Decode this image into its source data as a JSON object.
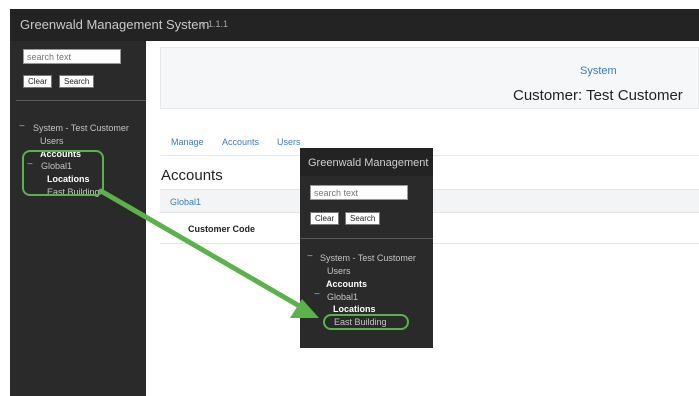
{
  "app": {
    "title": "Greenwald Management System",
    "version": "v 1.1.1"
  },
  "sidebar": {
    "search": {
      "placeholder": "search text",
      "value": ""
    },
    "clear_label": "Clear",
    "search_label": "Search",
    "tree": {
      "root_toggle": "−",
      "root_label": "System - Test Customer",
      "users_label": "Users",
      "accounts_label": "Accounts",
      "global_toggle": "−",
      "global_label": "Global1",
      "locations_label": "Locations",
      "east_building_label": "East Building"
    }
  },
  "header": {
    "system_link": "System",
    "customer_title": "Customer: Test Customer"
  },
  "tabs": [
    {
      "label": "Manage"
    },
    {
      "label": "Accounts"
    },
    {
      "label": "Users"
    }
  ],
  "accounts": {
    "title": "Accounts",
    "global_row": "Global1",
    "customer_code_label": "Customer Code"
  },
  "zoom": {
    "title": "Greenwald Management",
    "search": {
      "placeholder": "search text",
      "value": ""
    },
    "clear_label": "Clear",
    "search_label": "Search",
    "tree": {
      "root_toggle": "−",
      "root_label": "System - Test Customer",
      "users_label": "Users",
      "accounts_label": "Accounts",
      "global_toggle": "−",
      "global_label": "Global1",
      "locations_label": "Locations",
      "east_building_label": "East Building"
    }
  },
  "colors": {
    "highlight": "#5ab34a",
    "link": "#3a7bb8",
    "sidebar_bg": "#2a2a2a",
    "topbar_bg": "#232323"
  }
}
